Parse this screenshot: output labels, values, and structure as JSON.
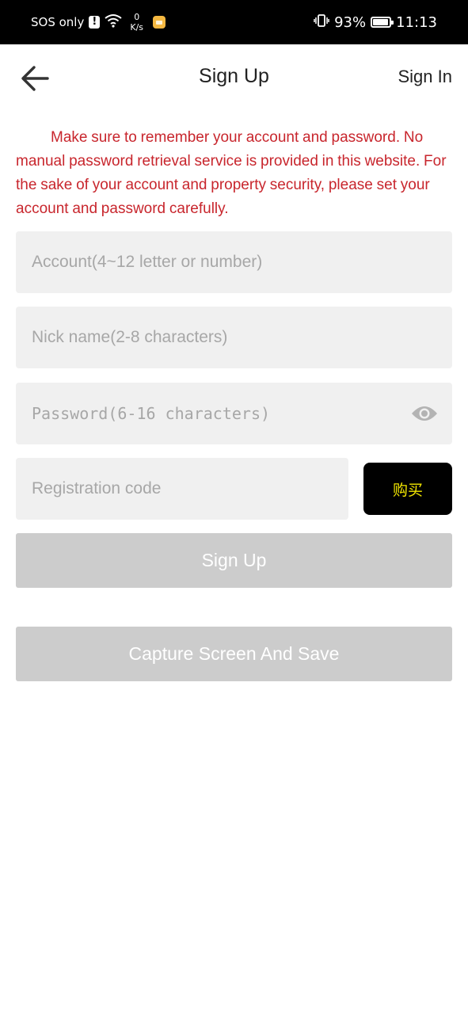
{
  "status_bar": {
    "carrier": "SOS only",
    "alert_glyph": "!",
    "net_speed_value": "0",
    "net_speed_unit": "K/s",
    "battery": "93%",
    "battery_level": 0.93,
    "time": "11:13",
    "icons": [
      "alert-icon",
      "wifi-icon",
      "app-notification-icon",
      "vibrate-icon",
      "battery-icon"
    ]
  },
  "nav": {
    "back_icon": "arrow-left-icon",
    "title": "Sign Up",
    "right_link": "Sign In"
  },
  "notice": "Make sure to remember your account and password. No manual password retrieval service is provided in this website. For the sake of your account and property security, please set your account and password carefully.",
  "form": {
    "account_placeholder": "Account(4~12 letter or number)",
    "account_value": "",
    "nickname_placeholder": "Nick name(2-8 characters)",
    "nickname_value": "",
    "password_placeholder": "Password(6-16 characters)",
    "password_value": "",
    "password_toggle_icon": "eye-icon",
    "regcode_placeholder": "Registration code",
    "regcode_value": "",
    "buy_label": "购买",
    "signup_label": "Sign Up",
    "capture_label": "Capture Screen And Save"
  },
  "colors": {
    "notice_text": "#c8262d",
    "field_bg": "#f0f0f0",
    "button_disabled": "#cccccc",
    "buy_button_bg": "#000000",
    "buy_button_text": "#f2e600"
  }
}
